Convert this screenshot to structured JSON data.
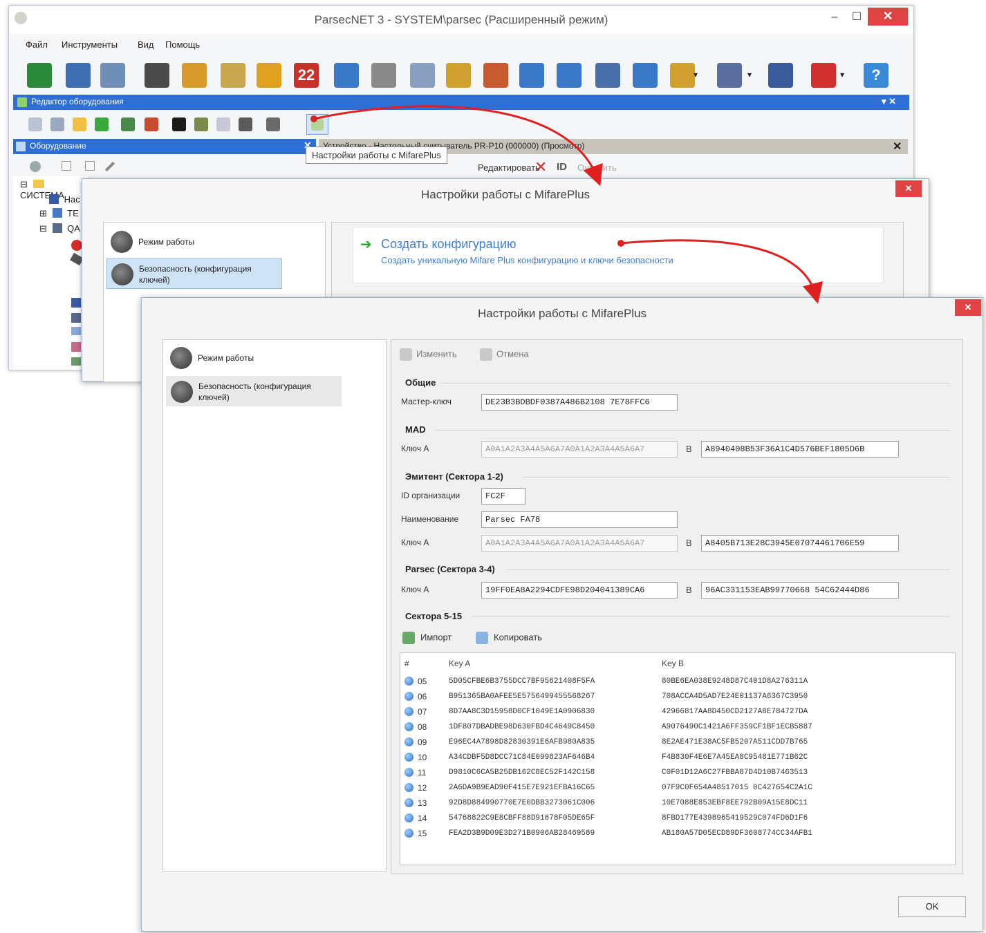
{
  "main": {
    "title": "ParsecNET 3 - SYSTEM\\parsec (Расширенный режим)",
    "window_controls": {
      "minimize": "–",
      "maximize": "☐",
      "close": "✕"
    },
    "menu": [
      "Файл",
      "Инструменты",
      "Вид",
      "Помощь"
    ],
    "toolbar_icons": [
      {
        "name": "hardware-icon",
        "color": "#2a8a3a"
      },
      {
        "name": "building-icon",
        "color": "#3d6fb0"
      },
      {
        "name": "cards-icon",
        "color": "#6f8fb8"
      },
      {
        "name": "person-icon",
        "color": "#4a4a4a"
      },
      {
        "name": "open-box-icon",
        "color": "#d89a2a"
      },
      {
        "name": "schedule-icon",
        "color": "#c9a650"
      },
      {
        "name": "lock-icon",
        "color": "#e0a020"
      },
      {
        "name": "number-22-icon",
        "color": "#c8302a",
        "text": "22"
      },
      {
        "name": "monitor-icon",
        "color": "#3a78c8"
      },
      {
        "name": "calendar-icon",
        "color": "#8a8a8a"
      },
      {
        "name": "settings-icon",
        "color": "#8aa0c0"
      },
      {
        "name": "report-icon",
        "color": "#d0a030"
      },
      {
        "name": "report-chart-icon",
        "color": "#c85a30"
      },
      {
        "name": "chart-icon",
        "color": "#3a78c8"
      },
      {
        "name": "chart2-icon",
        "color": "#3a78c8"
      },
      {
        "name": "id-card-icon",
        "color": "#4a6fa8"
      },
      {
        "name": "counter-icon",
        "color": "#3a78c8"
      },
      {
        "name": "door-icon",
        "color": "#d0a030"
      },
      {
        "name": "plugin-icon",
        "color": "#5a6fa0"
      },
      {
        "name": "user-key-icon",
        "color": "#3a5a9a"
      },
      {
        "name": "exit-icon",
        "color": "#d03030"
      },
      {
        "name": "help-icon",
        "color": "#3a88d8",
        "text": "?"
      }
    ],
    "editor_panel_title": "Редактор оборудования",
    "editor_panel_pin": "▾ ✕",
    "equipment_panel_title": "Оборудование",
    "equipment_panel_close": "✕",
    "tree": [
      {
        "text": "СИСТЕМА",
        "prefix": "⊟"
      },
      {
        "text": "Нас",
        "prefix": ""
      },
      {
        "text": "ТЕ",
        "prefix": "⊞"
      },
      {
        "text": "QA",
        "prefix": "⊟"
      }
    ],
    "device_panel_title": "Устройство - Настольный считыватель PR-P10 (000000) (Просмотр)",
    "device_panel_close": "✕",
    "device_toolbar": {
      "edit_label": "Редактировать",
      "clear_label": "Очистить"
    },
    "tooltip": "Настройки работы с MifarePlus"
  },
  "dialog1": {
    "title": "Настройки работы с MifarePlus",
    "close": "✕",
    "nav": [
      {
        "label": "Режим работы",
        "selected": false
      },
      {
        "label": "Безопасность (конфигурация ключей)",
        "selected": true
      }
    ],
    "action": {
      "title": "Создать конфигурацию",
      "description": "Создать уникальную Mifare Plus конфигурацию и ключи безопасности"
    }
  },
  "dialog2": {
    "title": "Настройки работы с MifarePlus",
    "close": "✕",
    "nav": [
      {
        "label": "Режим работы",
        "selected": false
      },
      {
        "label": "Безопасность (конфигурация ключей)",
        "selected": true
      }
    ],
    "toolbar": {
      "edit_label": "Изменить",
      "cancel_label": "Отмена"
    },
    "general": {
      "title": "Общие",
      "master_key_label": "Мастер-ключ",
      "master_key": "DE23B3BDBDF0387A486B2108 7E78FFC6"
    },
    "mad": {
      "title": "MAD",
      "key_a_label": "Ключ A",
      "key_a": "A0A1A2A3A4A5A6A7A0A1A2A3A4A5A6A7",
      "key_b_label": "B",
      "key_b": "A8940408B53F36A1C4D576BEF1805D6B"
    },
    "emitent": {
      "title": "Эмитент (Сектора 1-2)",
      "org_id_label": "ID организации",
      "org_id": "FC2F",
      "name_label": "Наименование",
      "name": "Parsec FA78",
      "key_a_label": "Ключ A",
      "key_a": "A0A1A2A3A4A5A6A7A0A1A2A3A4A5A6A7",
      "key_b_label": "B",
      "key_b": "A8405B713E28C3945E07074461706E59"
    },
    "parsec": {
      "title": "Parsec (Сектора 3-4)",
      "key_a_label": "Ключ A",
      "key_a": "19FF0EA8A2294CDFE98D204041389CA6",
      "key_b_label": "B",
      "key_b": "96AC331153EAB99770668 54C62444D86"
    },
    "sectors": {
      "title": "Сектора 5-15",
      "import_label": "Импорт",
      "copy_label": "Копировать",
      "columns": [
        "#",
        "Key A",
        "Key B"
      ],
      "rows": [
        [
          "05",
          "5D05CFBE6B3755DCC7BF95621408F5FA",
          "80BE6EA038E9248D87C401D8A276311A"
        ],
        [
          "06",
          "B951365BA0AFEE5E5756499455568267",
          "708ACCA4D5AD7E24E01137A6367C3950"
        ],
        [
          "07",
          "8D7AA8C3D15958D0CF1049E1A0906830",
          "42966817AA8D450CD2127A8E784727DA"
        ],
        [
          "08",
          "1DF807DBADBE98D630FBD4C4649C8450",
          "A9076490C1421A6FF359CF1BF1ECB5887"
        ],
        [
          "09",
          "E96EC4A7898D82830391E6AFB980A835",
          "8E2AE471E38AC5FB5207A511CDD7B765"
        ],
        [
          "10",
          "A34CDBF5D8DCC71C84E099823AF646B4",
          "F4B830F4E6E7A45EA8C95481E771B62C"
        ],
        [
          "11",
          "D9810C6CA5B25DB162C8EC52F142C158",
          "C0F01D12A6C27FBBA87D4D10B7463513"
        ],
        [
          "12",
          "2A6DA9B9EAD90F415E7E921EFBA16C65",
          "07F9C0F654A48517015 0C427654C2A1C"
        ],
        [
          "13",
          "92D8D884990770E7E0DBB3273061C006",
          "10E7088E853EBF8EE792B09A15E8DC11"
        ],
        [
          "14",
          "54768822C9E8CBFF88D91678F05DE65F",
          "8FBD177E4398965419529C074FD6D1F6"
        ],
        [
          "15",
          "FEA2D3B9D09E3D271B0906AB28469589",
          "AB180A57D05ECD89DF3608774CC34AFB1"
        ]
      ]
    },
    "ok_label": "OK"
  },
  "colors": {
    "accent_blue": "#2e6fd6",
    "close_red": "#e04343",
    "arrow_red": "#e02020",
    "link_blue": "#3f7fcf"
  }
}
